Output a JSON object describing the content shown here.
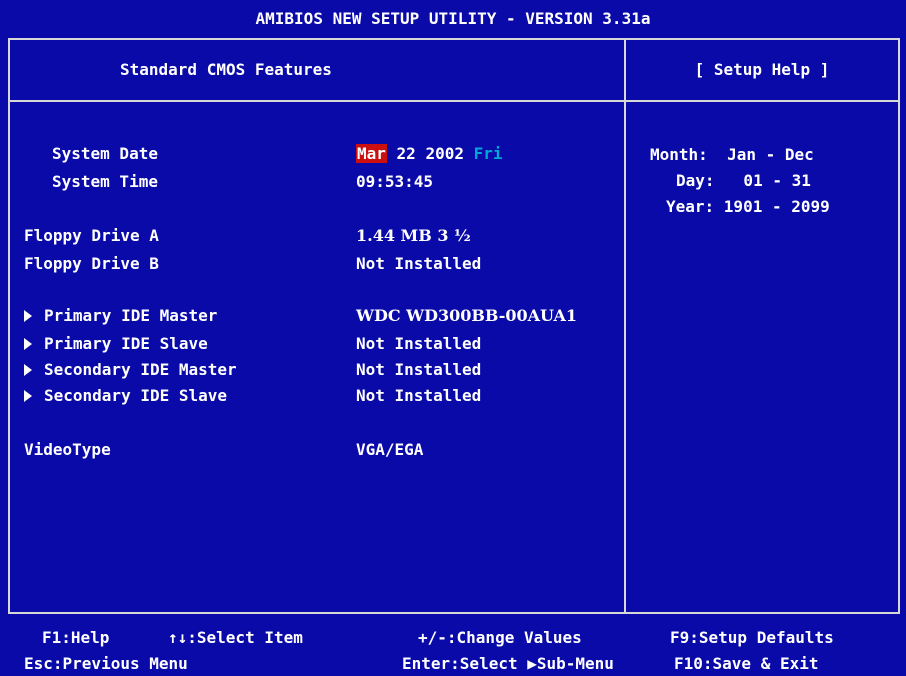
{
  "title": "AMIBIOS NEW SETUP UTILITY - VERSION 3.31a",
  "headers": {
    "left": "Standard CMOS Features",
    "right": "[ Setup Help ]"
  },
  "fields": {
    "system_date": {
      "label": "System Date",
      "month": "Mar",
      "date": "22 2002",
      "weekday": "Fri"
    },
    "system_time": {
      "label": "System Time",
      "value": "09:53:45"
    },
    "floppy_a": {
      "label": "Floppy Drive A",
      "value": "1.44 MB 3 ½"
    },
    "floppy_b": {
      "label": "Floppy Drive B",
      "value": "Not Installed"
    },
    "primary_master": {
      "label": "Primary IDE Master",
      "value": "WDC WD300BB-00AUA1"
    },
    "primary_slave": {
      "label": "Primary IDE Slave",
      "value": "Not Installed"
    },
    "secondary_master": {
      "label": "Secondary IDE Master",
      "value": "Not Installed"
    },
    "secondary_slave": {
      "label": "Secondary IDE Slave",
      "value": "Not Installed"
    },
    "video_type": {
      "label": "VideoType",
      "value": "VGA/EGA"
    }
  },
  "help": {
    "month": "Month:  Jan - Dec",
    "day": "Day:   01 - 31",
    "year": "Year: 1901 - 2099"
  },
  "footer": {
    "f1": "F1:Help",
    "select_item": "↑↓:Select Item",
    "change_values": "+/-:Change Values",
    "f9": "F9:Setup Defaults",
    "esc": "Esc:Previous Menu",
    "enter": "Enter:Select ▶Sub-Menu",
    "f10": "F10:Save & Exit"
  },
  "colors": {
    "background": "#0a0aa8",
    "text": "#ffffff",
    "highlight_bg": "#cc1010",
    "weekday": "#00a8d8",
    "border": "#d8d8d8"
  }
}
